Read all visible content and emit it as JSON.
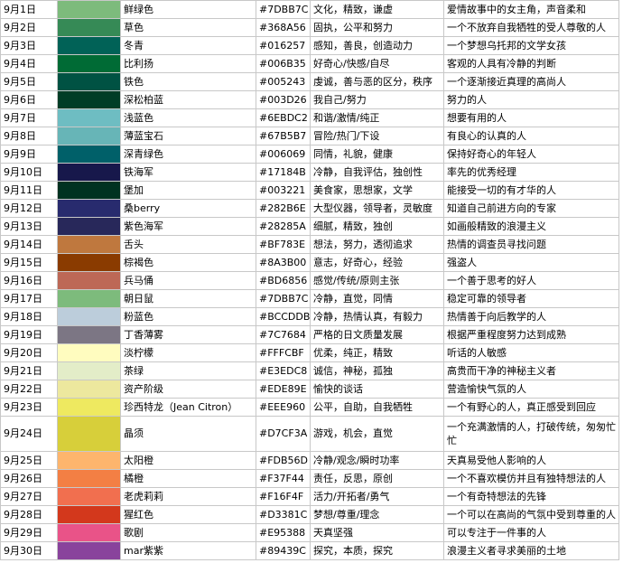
{
  "rows": [
    {
      "date": "9月1日",
      "color": "#7DBB7C",
      "name": "鲜绿色",
      "hex": "#7DBB7C",
      "traits": "文化，精致，谦虚",
      "meaning": "爱情故事中的女主角，声音柔和"
    },
    {
      "date": "9月2日",
      "color": "#368A56",
      "name": "草色",
      "hex": "#368A56",
      "traits": "固执，公平和努力",
      "meaning": "一个不放弃自我牺牲的受人尊敬的人"
    },
    {
      "date": "9月3日",
      "color": "#016257",
      "name": "冬青",
      "hex": "#016257",
      "traits": "感知，善良，创造动力",
      "meaning": "一个梦想乌托邦的文学女孩"
    },
    {
      "date": "9月4日",
      "color": "#006B35",
      "name": "比利扬",
      "hex": "#006B35",
      "traits": "好奇心/快感/自尽",
      "meaning": "客观的人具有冷静的判断"
    },
    {
      "date": "9月5日",
      "color": "#005243",
      "name": "铁色",
      "hex": "#005243",
      "traits": "虔诚，善与恶的区分，秩序",
      "meaning": "一个逐渐接近真理的高尚人"
    },
    {
      "date": "9月6日",
      "color": "#003D26",
      "name": "深松柏蓝",
      "hex": "#003D26",
      "traits": "我自己/努力",
      "meaning": "努力的人"
    },
    {
      "date": "9月7日",
      "color": "#6EBDC2",
      "name": "浅蓝色",
      "hex": "#6EBDC2",
      "traits": "和谐/激情/纯正",
      "meaning": "想要有用的人"
    },
    {
      "date": "9月8日",
      "color": "#67B5B7",
      "name": "薄蓝宝石",
      "hex": "#67B5B7",
      "traits": "冒险/热门/下设",
      "meaning": "有良心的认真的人"
    },
    {
      "date": "9月9日",
      "color": "#006069",
      "name": "深青绿色",
      "hex": "#006069",
      "traits": "同情，礼貌，健康",
      "meaning": "保持好奇心的年轻人"
    },
    {
      "date": "9月10日",
      "color": "#17184B",
      "name": "铁海军",
      "hex": "#17184B",
      "traits": "冷静，自我评估，独创性",
      "meaning": "率先的优秀经理"
    },
    {
      "date": "9月11日",
      "color": "#003221",
      "name": "堡加",
      "hex": "#003221",
      "traits": "美食家，思想家，文学",
      "meaning": "能接受一切的有才华的人"
    },
    {
      "date": "9月12日",
      "color": "#282B6E",
      "name": "桑berry",
      "hex": "#282B6E",
      "traits": "大型仪器，领导者，灵敏度",
      "meaning": "知道自己前进方向的专家"
    },
    {
      "date": "9月13日",
      "color": "#28285A",
      "name": "紫色海军",
      "hex": "#28285A",
      "traits": "细腻，精致，独创",
      "meaning": "如画般精致的浪漫主义"
    },
    {
      "date": "9月14日",
      "color": "#BF783E",
      "name": "舌头",
      "hex": "#BF783E",
      "traits": "想法，努力，透彻追求",
      "meaning": "热情的调查员寻找问题"
    },
    {
      "date": "9月15日",
      "color": "#8A3B00",
      "name": "棕褐色",
      "hex": "#8A3B00",
      "traits": "意志，好奇心，经验",
      "meaning": "强盗人"
    },
    {
      "date": "9月16日",
      "color": "#BD6856",
      "name": "兵马俑",
      "hex": "#BD6856",
      "traits": "感觉/传统/原则主张",
      "meaning": "一个善于思考的好人"
    },
    {
      "date": "9月17日",
      "color": "#7DBB7C",
      "name": "朝日鼠",
      "hex": "#7DBB7C",
      "traits": "冷静，直觉，同情",
      "meaning": "稳定可靠的领导者"
    },
    {
      "date": "9月18日",
      "color": "#BCCDDB",
      "name": "粉蓝色",
      "hex": "#BCCDDB",
      "traits": "冷静，热情认真，有毅力",
      "meaning": "热情善于向后教学的人"
    },
    {
      "date": "9月19日",
      "color": "#7C7684",
      "name": "丁香薄雾",
      "hex": "#7C7684",
      "traits": "严格的日文质量发展",
      "meaning": "根据严重程度努力达到成熟"
    },
    {
      "date": "9月20日",
      "color": "#FFFCBF",
      "name": "淡柠檬",
      "hex": "#FFFCBF",
      "traits": "优柔，纯正，精致",
      "meaning": "听话的人敏感"
    },
    {
      "date": "9月21日",
      "color": "#E3EDC8",
      "name": "茶绿",
      "hex": "#E3EDC8",
      "traits": "诚信，神秘，孤独",
      "meaning": "高贵而干净的神秘主义者"
    },
    {
      "date": "9月22日",
      "color": "#EDE89E",
      "name": "资产阶级",
      "hex": "#EDE89E",
      "traits": "愉快的谈话",
      "meaning": "营造愉快气氛的人"
    },
    {
      "date": "9月23日",
      "color": "#EEE960",
      "name": "珍西特龙（Jean Citron）",
      "hex": "#EEE960",
      "traits": "公平，自助，自我牺牲",
      "meaning": "一个有野心的人，真正感受到回应"
    },
    {
      "date": "9月24日",
      "color": "#D7CF3A",
      "name": "晶须",
      "hex": "#D7CF3A",
      "traits": "游戏，机会，直觉",
      "meaning": "一个充满激情的人，打破传统，匆匆忙忙",
      "tall": true
    },
    {
      "date": "9月25日",
      "color": "#FDB56D",
      "name": "太阳橙",
      "hex": "#FDB56D",
      "traits": "冷静/观念/瞬时功率",
      "meaning": "天真易受他人影响的人"
    },
    {
      "date": "9月26日",
      "color": "#F37F44",
      "name": "橘橙",
      "hex": "#F37F44",
      "traits": "责任，反思，原创",
      "meaning": "一个不喜欢模仿并且有独特想法的人"
    },
    {
      "date": "9月27日",
      "color": "#F16F4F",
      "name": "老虎莉莉",
      "hex": "#F16F4F",
      "traits": "活力/开拓者/勇气",
      "meaning": "一个有奇特想法的先锋"
    },
    {
      "date": "9月28日",
      "color": "#D3381C",
      "name": "猩红色",
      "hex": "#D3381C",
      "traits": "梦想/尊重/理念",
      "meaning": "一个可以在高尚的气氛中受到尊重的人"
    },
    {
      "date": "9月29日",
      "color": "#E95388",
      "name": "歌剧",
      "hex": "#E95388",
      "traits": "天真坚强",
      "meaning": "可以专注于一件事的人"
    },
    {
      "date": "9月30日",
      "color": "#89439C",
      "name": "mar紫紫",
      "hex": "#89439C",
      "traits": "探究，本质，探究",
      "meaning": "浪漫主义者寻求美丽的土地"
    }
  ]
}
